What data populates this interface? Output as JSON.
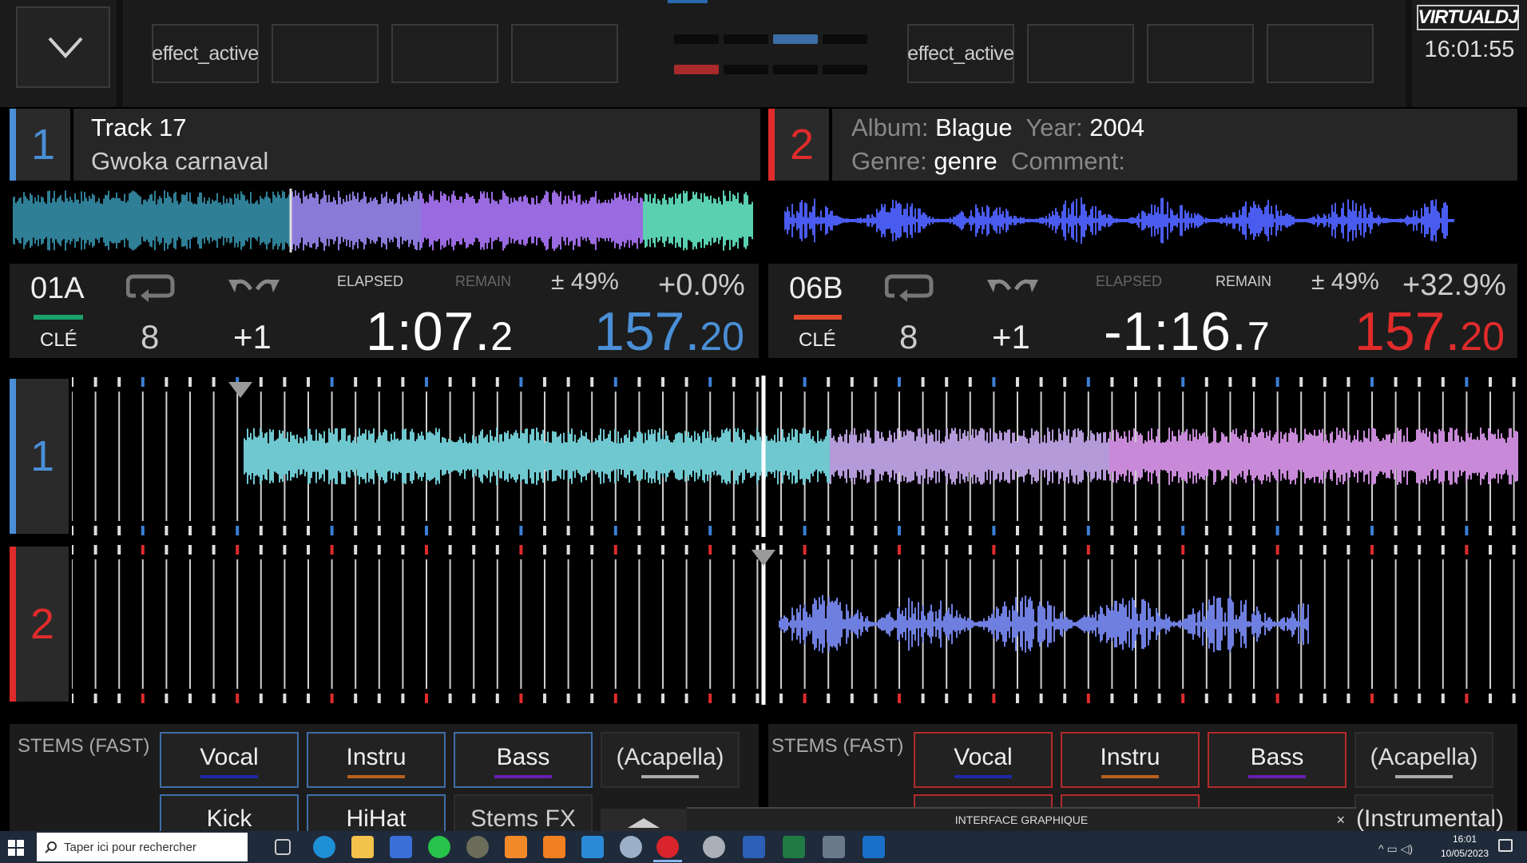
{
  "top": {
    "menu_icon": "chevron-down-icon",
    "deck1_effects": [
      "effect_active",
      "",
      "",
      ""
    ],
    "deck2_effects": [
      "effect_active",
      "",
      "",
      ""
    ],
    "logo": "VIRTUALDJ",
    "clock": "16:01:55"
  },
  "deck1": {
    "number": "1",
    "title": "Track 17",
    "artist": "Gwoka carnaval",
    "key": "01A",
    "key_label": "CLÉ",
    "loop_value": "8",
    "jump_value": "+1",
    "elapsed_label": "ELAPSED",
    "remain_label": "REMAIN",
    "time_main": "1:07.",
    "time_frac": "2",
    "pitch_range": "± 49%",
    "pitch": "+0.0%",
    "bpm_main": "157.",
    "bpm_frac": "20",
    "color": "#4a8fd6",
    "key_color": "#1aa06a"
  },
  "deck2": {
    "number": "2",
    "album_label": "Album:",
    "album": "Blague",
    "year_label": "Year:",
    "year": "2004",
    "genre_label": "Genre:",
    "genre": "genre",
    "comment_label": "Comment:",
    "key": "06B",
    "key_label": "CLÉ",
    "loop_value": "8",
    "jump_value": "+1",
    "elapsed_label": "ELAPSED",
    "remain_label": "REMAIN",
    "time_main": "-1:16.",
    "time_frac": "7",
    "pitch_range": "± 49%",
    "pitch": "+32.9%",
    "bpm_main": "157.",
    "bpm_frac": "20",
    "color": "#e02b2b",
    "key_color": "#e04a2a"
  },
  "waves": {
    "deck1_label": "1",
    "deck2_label": "2"
  },
  "stems1": {
    "title": "STEMS (FAST)",
    "row1": [
      "Vocal",
      "Instru",
      "Bass",
      "(Acapella)"
    ],
    "row2": [
      "Kick",
      "HiHat",
      "Stems FX",
      ""
    ]
  },
  "stems2": {
    "title": "STEMS (FAST)",
    "row1": [
      "Vocal",
      "Instru",
      "Bass",
      "(Acapella)"
    ],
    "row2": [
      "",
      "",
      "",
      "(Instrumental)"
    ]
  },
  "popup": {
    "title": "INTERFACE GRAPHIQUE",
    "close": "×"
  },
  "taskbar": {
    "search_placeholder": "Taper ici pour rechercher",
    "time": "16:01",
    "date": "10/05/2023",
    "icons": [
      "windows-start-icon",
      "search-icon",
      "task-view-icon",
      "edge-icon",
      "file-explorer-icon",
      "store-icon",
      "whatsapp-icon",
      "app-icon",
      "media-player-icon",
      "vlc-icon",
      "arrow-app-icon",
      "paint-icon",
      "virtualdj-icon",
      "cloud-icon",
      "word-icon",
      "excel-icon",
      "calculator-icon",
      "outlook-icon"
    ]
  }
}
